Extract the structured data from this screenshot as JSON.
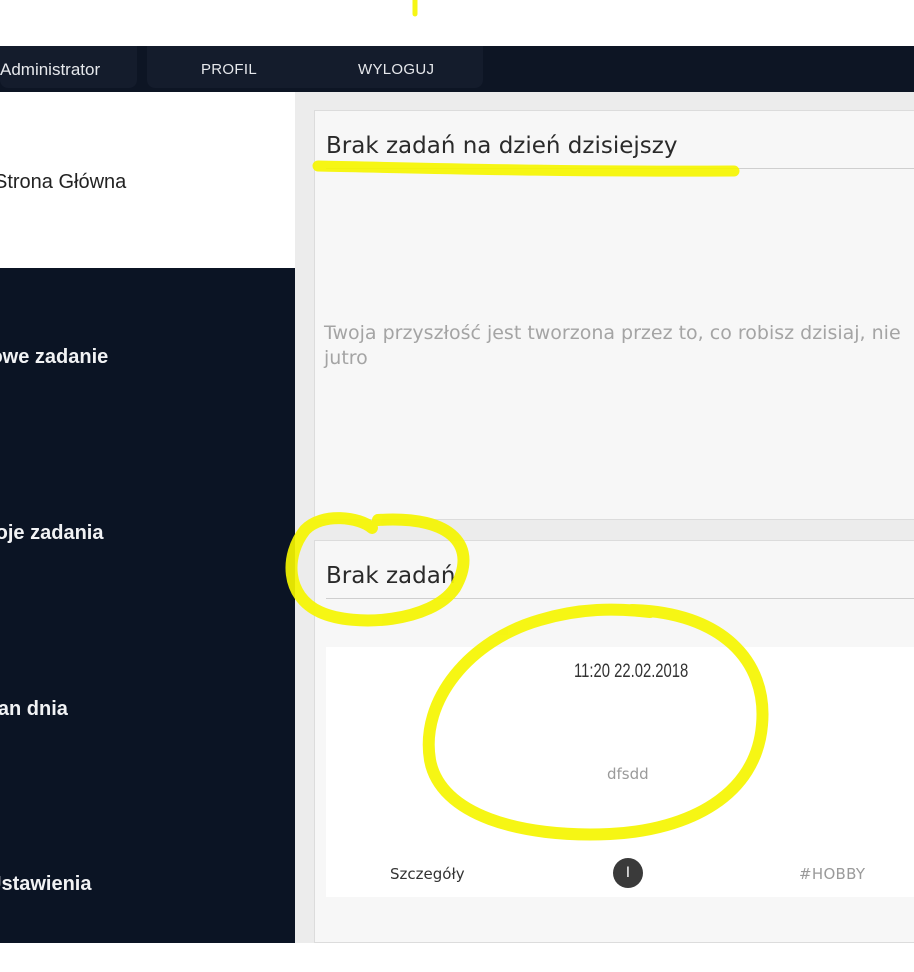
{
  "navbar": {
    "user_name": "Administrator",
    "profile_label": "PROFIL",
    "logout_label": "WYLOGUJ"
  },
  "sidebar": {
    "items": [
      {
        "label": "Strona Główna",
        "active": true
      },
      {
        "label": "Nowe zadanie",
        "active": false
      },
      {
        "label": "Moje zadania",
        "active": false
      },
      {
        "label": "Plan dnia",
        "active": false
      },
      {
        "label": "Ustawienia",
        "active": false
      }
    ]
  },
  "today_panel": {
    "title": "Brak zadań na dzień dzisiejszy",
    "quote_line1": "Twoja przyszłość jest tworzona przez to, co robisz dzisiaj, nie",
    "quote_line2": "jutro"
  },
  "tasks_panel": {
    "title": "Brak zadań",
    "card": {
      "time": "11:20 22.02.2018",
      "description": "dfsdd",
      "details_label": "Szczegóły",
      "badge": "I",
      "tag": "#HOBBY"
    }
  },
  "colors": {
    "navbar_bg": "#0d1524",
    "sidebar_bg": "#0b1424",
    "highlighter": "#f5f500"
  }
}
